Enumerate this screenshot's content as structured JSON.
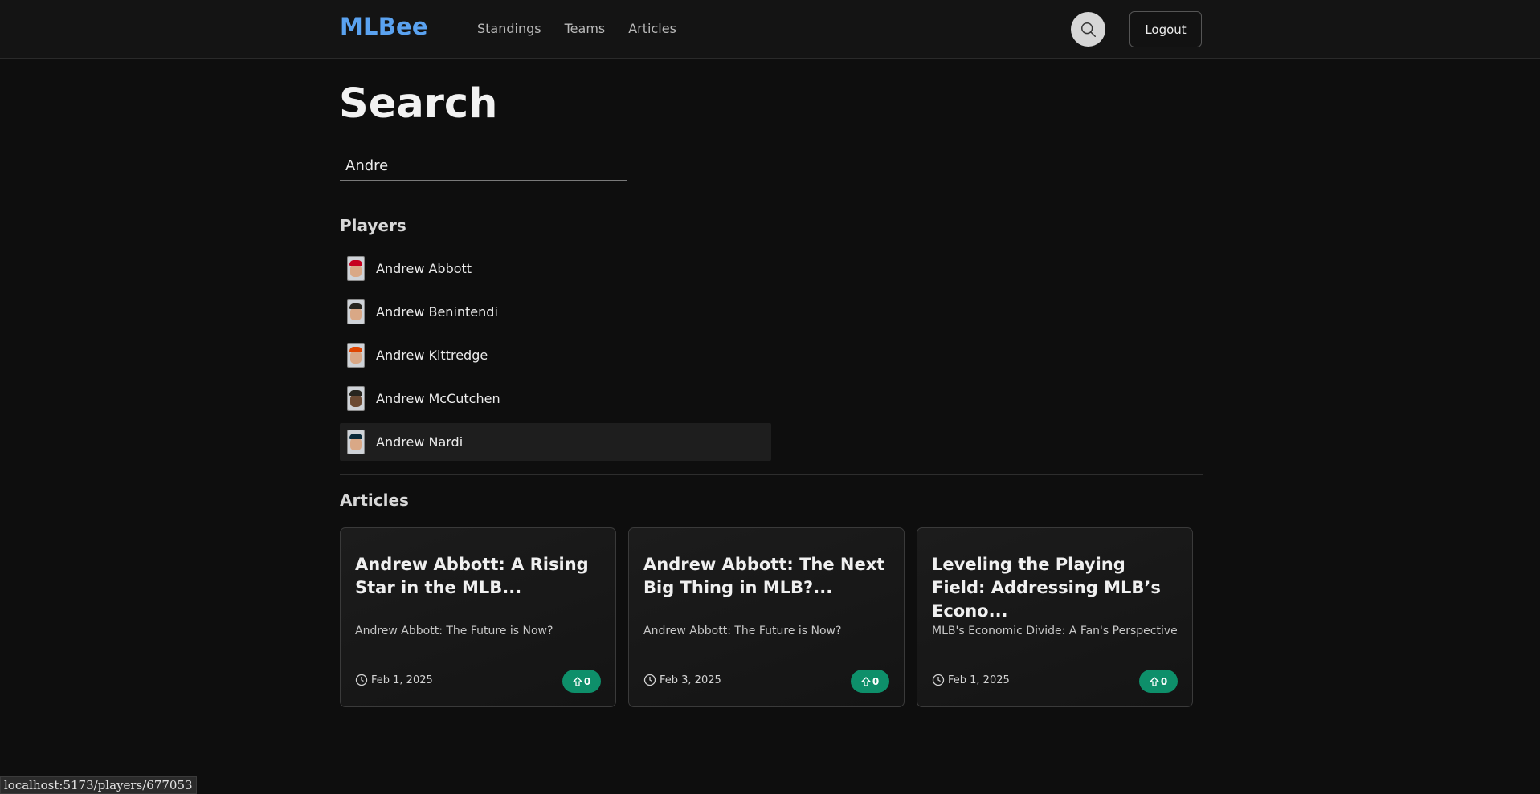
{
  "nav": {
    "logo": "MLBee",
    "links": [
      "Standings",
      "Teams",
      "Articles"
    ],
    "logout_label": "Logout",
    "search_icon": "search-icon"
  },
  "page": {
    "title": "Search",
    "search_value": "Andre"
  },
  "players": {
    "heading": "Players",
    "items": [
      {
        "name": "Andrew Abbott",
        "cap_color": "#c6011f"
      },
      {
        "name": "Andrew Benintendi",
        "cap_color": "#27251f"
      },
      {
        "name": "Andrew Kittredge",
        "cap_color": "#df4601"
      },
      {
        "name": "Andrew McCutchen",
        "cap_color": "#27251f"
      },
      {
        "name": "Andrew Nardi",
        "cap_color": "#0a2a3a"
      }
    ]
  },
  "articles": {
    "heading": "Articles",
    "items": [
      {
        "title": "Andrew Abbott: A Rising Star in the MLB...",
        "subtitle": "Andrew Abbott: The Future is Now?",
        "date": "Feb 1, 2025",
        "votes": "0"
      },
      {
        "title": "Andrew Abbott: The Next Big Thing in MLB?...",
        "subtitle": "Andrew Abbott: The Future is Now?",
        "date": "Feb 3, 2025",
        "votes": "0"
      },
      {
        "title": "Leveling the Playing Field: Addressing MLB’s Econo...",
        "subtitle": "MLB's Economic Divide: A Fan's Perspective",
        "date": "Feb 1, 2025",
        "votes": "0"
      }
    ]
  },
  "status_bar": {
    "url": "localhost:5173/players/677053"
  },
  "colors": {
    "accent": "#5aa2f0",
    "vote_badge": "#0e8f6a",
    "background": "#0e0e0e"
  }
}
